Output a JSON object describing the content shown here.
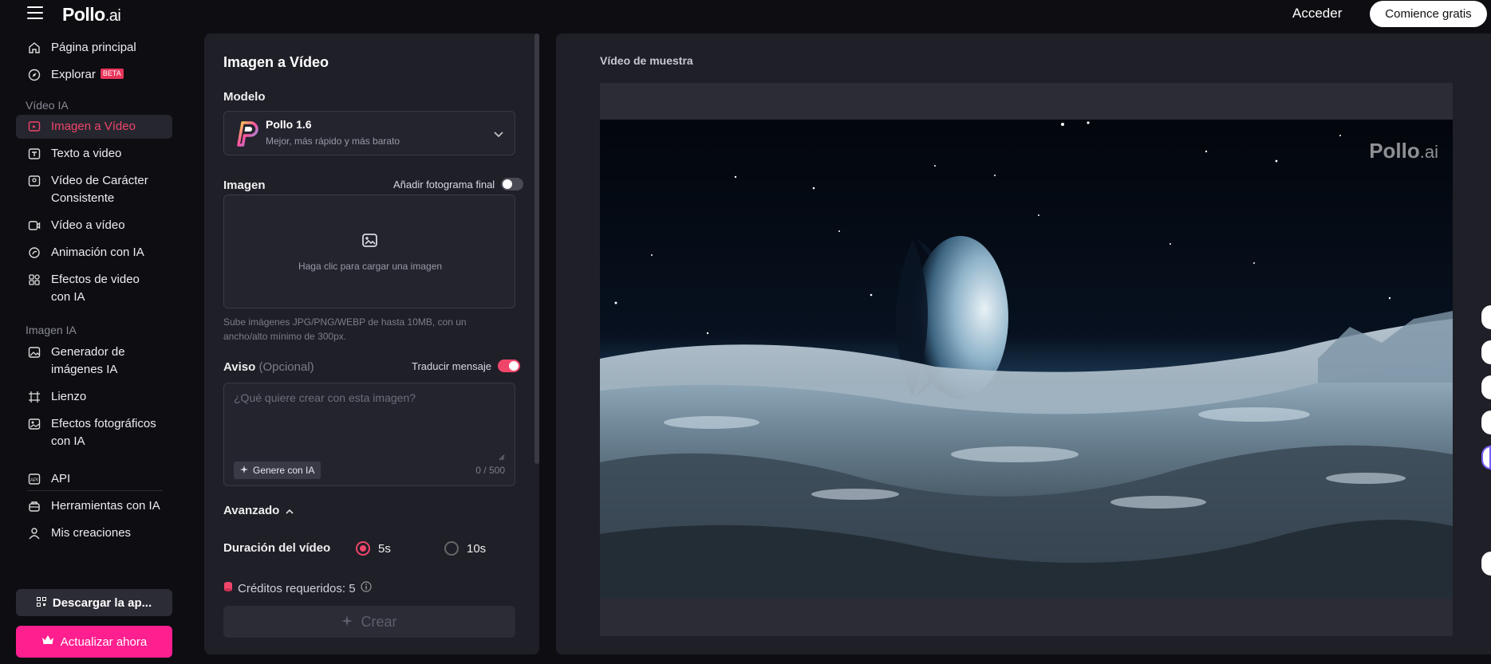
{
  "header": {
    "logo_text": "Pollo",
    "logo_suffix": ".ai",
    "login": "Acceder",
    "cta": "Comience gratis"
  },
  "sidebar": {
    "items_top": [
      {
        "label": "Página principal",
        "icon": "home-icon"
      },
      {
        "label": "Explorar",
        "badge": "BETA",
        "icon": "compass-icon"
      }
    ],
    "section_video": "Vídeo IA",
    "items_video": [
      {
        "label": "Imagen a Vídeo",
        "icon": "image-video-icon",
        "active": true
      },
      {
        "label": "Texto a video",
        "icon": "text-video-icon"
      },
      {
        "label": "Vídeo de Carácter Consistente",
        "icon": "character-icon"
      },
      {
        "label": "Vídeo a vídeo",
        "icon": "video-video-icon"
      },
      {
        "label": "Animación con IA",
        "icon": "animation-icon"
      },
      {
        "label": "Efectos de video con IA",
        "icon": "effects-icon"
      }
    ],
    "section_image": "Imagen IA",
    "items_image": [
      {
        "label": "Generador de imágenes IA",
        "icon": "image-gen-icon"
      },
      {
        "label": "Lienzo",
        "icon": "canvas-icon"
      },
      {
        "label": "Efectos fotográficos con IA",
        "icon": "photo-effects-icon"
      }
    ],
    "items_bottom": [
      {
        "label": "API",
        "icon": "api-icon"
      },
      {
        "label": "Herramientas con IA",
        "icon": "tools-icon"
      },
      {
        "label": "Mis creaciones",
        "icon": "creations-icon"
      }
    ],
    "download": "Descargar la ap...",
    "upgrade": "Actualizar ahora"
  },
  "form": {
    "title": "Imagen a Vídeo",
    "model_label": "Modelo",
    "model_name": "Pollo 1.6",
    "model_sub": "Mejor, más rápido y más barato",
    "image_label": "Imagen",
    "final_frame_toggle": "Añadir fotograma final",
    "final_frame_on": false,
    "upload_text": "Haga clic para cargar una imagen",
    "upload_hint": "Sube imágenes JPG/PNG/WEBP de hasta 10MB, con un ancho/alto mínimo de 300px.",
    "prompt_label": "Aviso",
    "prompt_optional": "(Opcional)",
    "translate_toggle": "Traducir mensaje",
    "translate_on": true,
    "prompt_placeholder": "¿Qué quiere crear con esta imagen?",
    "generate_ai": "Genere con IA",
    "counter": "0 / 500",
    "advanced": "Avanzado",
    "duration_label": "Duración del vídeo",
    "duration_options": [
      "5s",
      "10s"
    ],
    "duration_selected": "5s",
    "credits": "Créditos requeridos: 5",
    "create": "Crear"
  },
  "preview": {
    "title": "Vídeo de muestra",
    "watermark": "Pollo",
    "watermark_suffix": ".ai"
  },
  "colors": {
    "accent": "#f0456a",
    "upgrade": "#ff1f8f",
    "panel": "#1f1f28",
    "background": "#0d0d12"
  }
}
